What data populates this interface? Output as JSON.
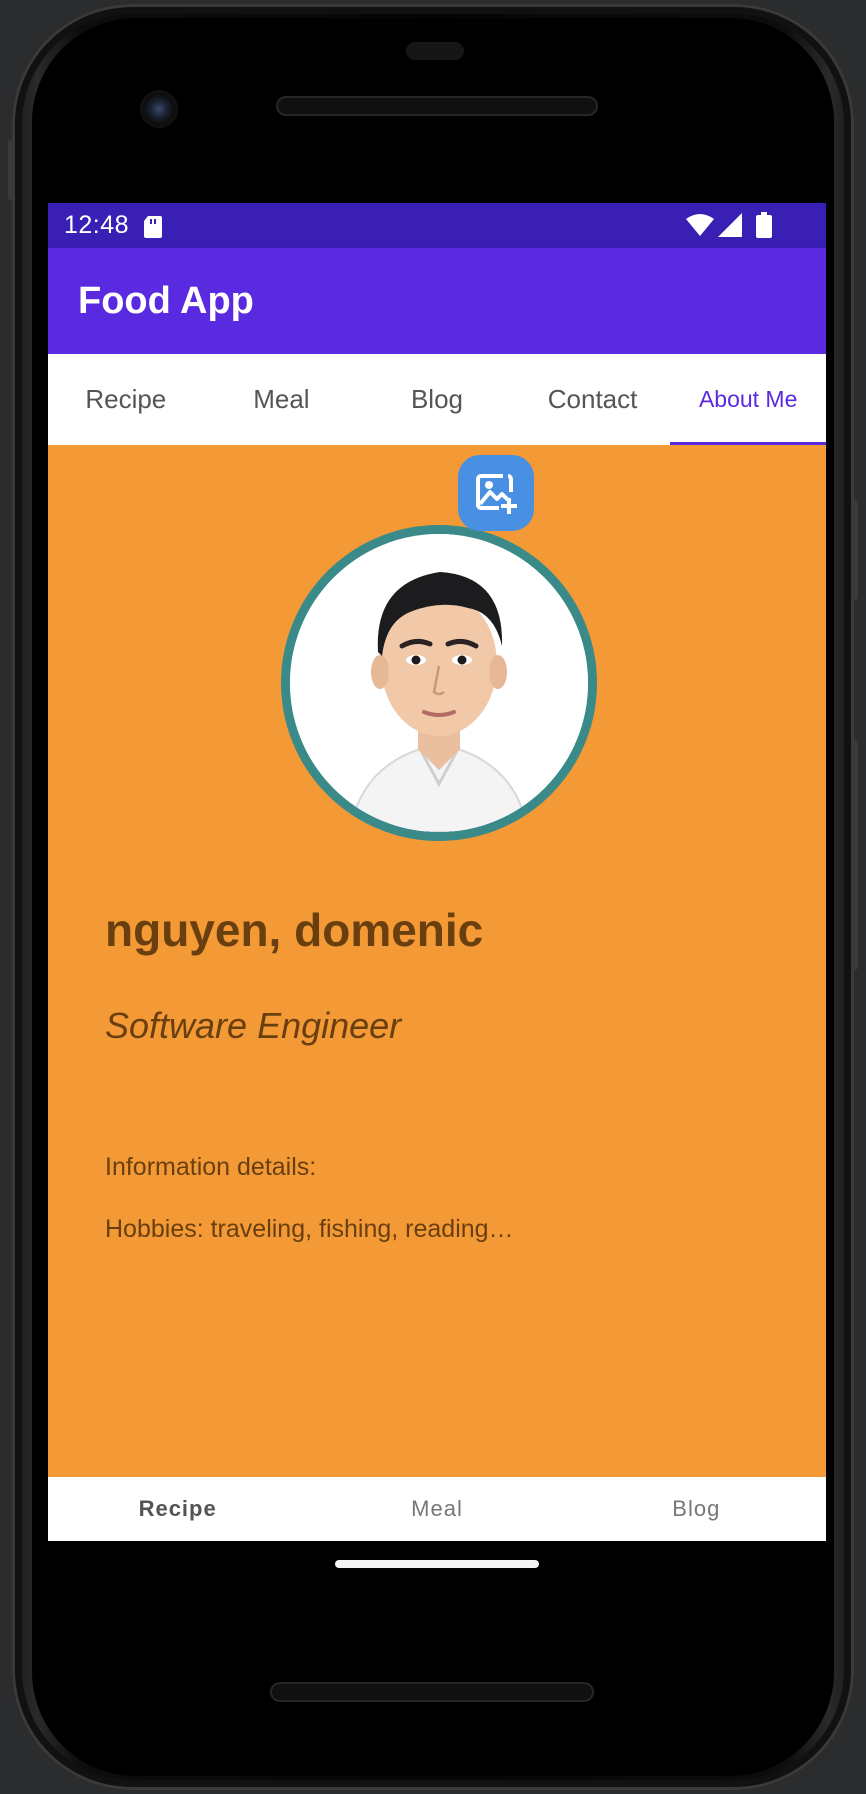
{
  "status_bar": {
    "time": "12:48"
  },
  "app_bar": {
    "title": "Food App"
  },
  "top_tabs": [
    {
      "label": "Recipe",
      "active": false
    },
    {
      "label": "Meal",
      "active": false
    },
    {
      "label": "Blog",
      "active": false
    },
    {
      "label": "Contact",
      "active": false
    },
    {
      "label": "About Me",
      "active": true
    }
  ],
  "profile": {
    "name": "nguyen, domenic",
    "job_title": "Software Engineer",
    "info_label": "Information details:",
    "hobbies": "Hobbies: traveling, fishing, reading…"
  },
  "bottom_nav": [
    {
      "label": "Recipe",
      "active": true
    },
    {
      "label": "Meal",
      "active": false
    },
    {
      "label": "Blog",
      "active": false
    }
  ],
  "colors": {
    "status_bar": "#3a1fb4",
    "app_bar": "#5a2ae0",
    "background": "#f39a36",
    "avatar_border": "#3a8a8a",
    "add_photo_button": "#4a90e2",
    "text_primary": "#6a3f10"
  },
  "icons": {
    "sd_card": "sd-card-icon",
    "wifi": "wifi-icon",
    "signal": "cell-signal-icon",
    "battery": "battery-icon",
    "add_photo": "add-photo-icon"
  }
}
